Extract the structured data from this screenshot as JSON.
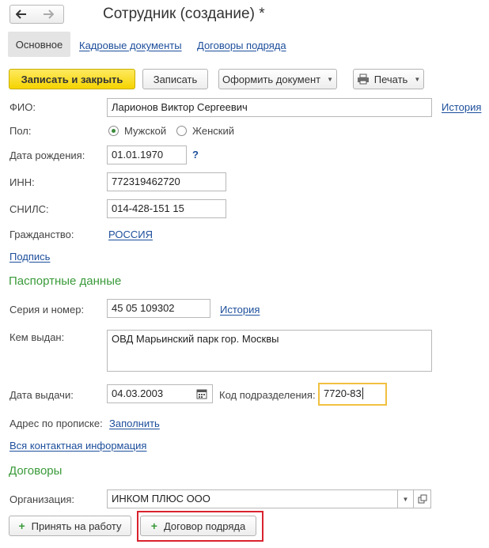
{
  "window": {
    "title": "Сотрудник (создание) *"
  },
  "tabs": [
    {
      "label": "Основное",
      "active": true
    },
    {
      "label": "Кадровые документы",
      "active": false
    },
    {
      "label": "Договоры подряда",
      "active": false
    }
  ],
  "toolbar": {
    "save_close": "Записать и закрыть",
    "save": "Записать",
    "issue_doc": "Оформить документ",
    "print": "Печать"
  },
  "form": {
    "fio_label": "ФИО:",
    "fio_value": "Ларионов Виктор Сергеевич",
    "fio_history": "История",
    "gender_label": "Пол:",
    "gender_male": "Мужской",
    "gender_female": "Женский",
    "gender_selected": "Мужской",
    "birth_label": "Дата рождения:",
    "birth_value": "01.01.1970",
    "birth_help": "?",
    "inn_label": "ИНН:",
    "inn_value": "772319462720",
    "snils_label": "СНИЛС:",
    "snils_value": "014-428-151 15",
    "citizenship_label": "Гражданство:",
    "citizenship_value": "РОССИЯ",
    "signature_link": "Подпись"
  },
  "passport": {
    "section_title": "Паспортные данные",
    "series_label": "Серия и номер:",
    "series_value": "45 05 109302",
    "history_link": "История",
    "issued_by_label": "Кем выдан:",
    "issued_by_value": "ОВД Марьинский парк гор. Москвы",
    "issue_date_label": "Дата выдачи:",
    "issue_date_value": "04.03.2003",
    "dept_code_label": "Код подразделения:",
    "dept_code_value": "7720-83",
    "address_label": "Адрес по прописке:",
    "address_fill_link": "Заполнить",
    "contacts_link": "Вся контактная информация"
  },
  "contracts": {
    "section_title": "Договоры",
    "org_label": "Организация:",
    "org_value": "ИНКОМ ПЛЮС ООО",
    "hire_button": "Принять на работу",
    "contract_button": "Договор подряда"
  },
  "colors": {
    "accent_green": "#3a9a3a",
    "link_blue": "#1c4e9b",
    "highlight_red": "#d9232e",
    "focus_yellow": "#f0c040"
  }
}
